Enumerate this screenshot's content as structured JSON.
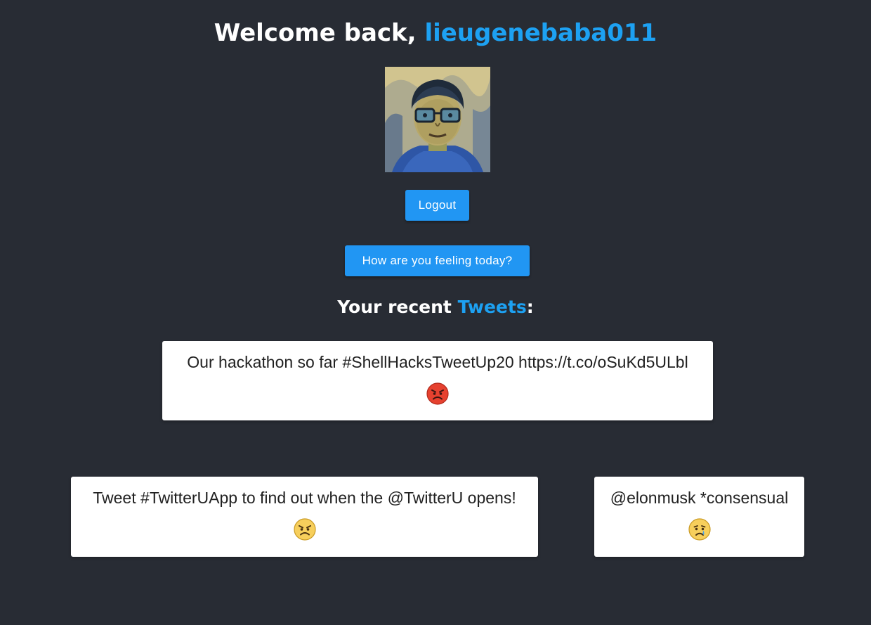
{
  "header": {
    "welcome_prefix": "Welcome back, ",
    "username": "lieugenebaba011"
  },
  "avatar": {
    "description_icon": "avatar"
  },
  "buttons": {
    "logout_label": "Logout",
    "feeling_label": "How are you feeling today?"
  },
  "recent": {
    "prefix": "Your recent ",
    "highlight": "Tweets",
    "suffix": ":"
  },
  "tweets": [
    {
      "text": "Our hackathon so far #ShellHacksTweetUp20 https://t.co/oSuKd5ULbl",
      "emotion_icon": "angry-red-face-icon"
    },
    {
      "text": "Tweet #TwitterUApp to find out when the @TwitterU opens!",
      "emotion_icon": "annoyed-face-icon"
    },
    {
      "text": "@elonmusk *consensual",
      "emotion_icon": "crying-face-icon"
    }
  ],
  "colors": {
    "background": "#282c34",
    "accent": "#1da1f2",
    "button": "#2196f3",
    "card": "#ffffff"
  }
}
